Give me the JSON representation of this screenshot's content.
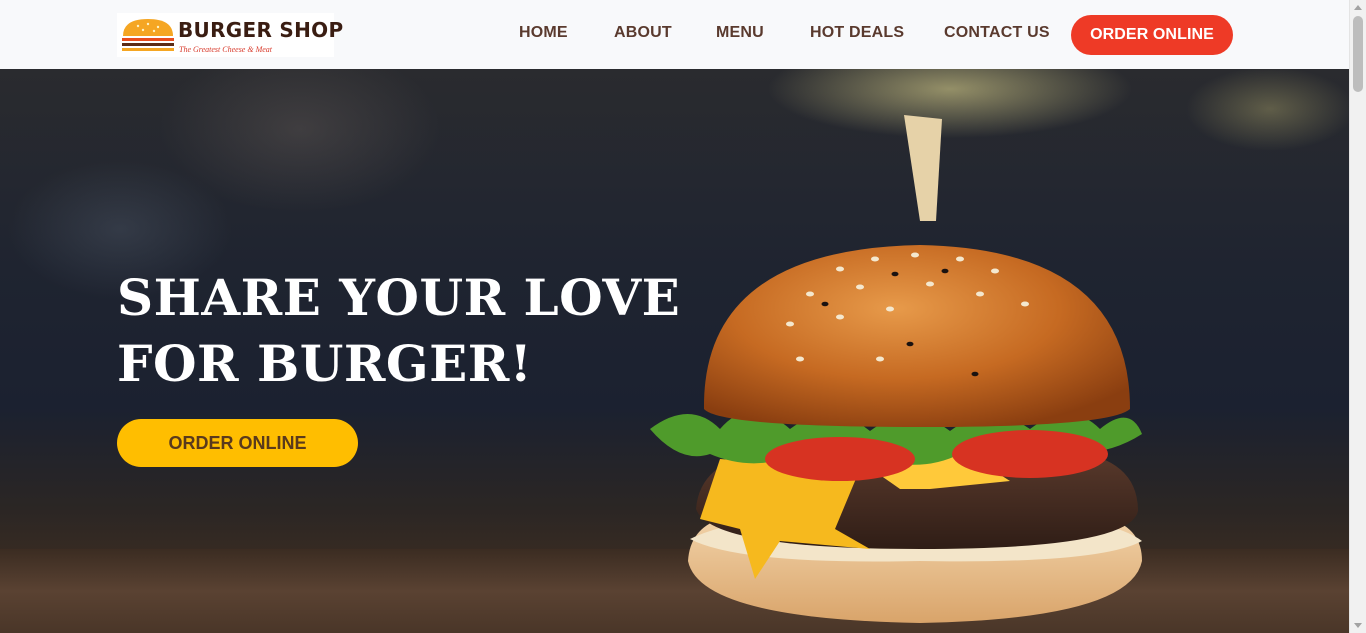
{
  "brand": {
    "name": "BURGER SHOP",
    "tagline": "The Greatest Cheese & Meat",
    "logo_icon": "burger-icon"
  },
  "nav": {
    "items": [
      {
        "label": "HOME"
      },
      {
        "label": "ABOUT"
      },
      {
        "label": "MENU"
      },
      {
        "label": "HOT DEALS"
      },
      {
        "label": "CONTACT US"
      }
    ],
    "cta_label": "ORDER ONLINE"
  },
  "hero": {
    "title_line1": "SHARE YOUR LOVE",
    "title_line2": "FOR BURGER!",
    "cta_label": "ORDER ONLINE",
    "image": "burger-photo"
  },
  "colors": {
    "nav_text": "#5a3a2e",
    "nav_cta": "#ee3a26",
    "hero_cta": "#ffbe00",
    "hero_cta_text": "#5a3a1c",
    "header_bg": "#f8f9fb"
  }
}
